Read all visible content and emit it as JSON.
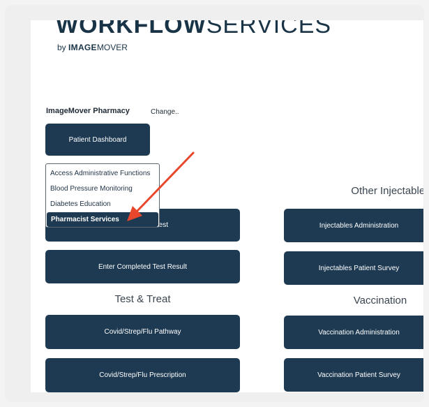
{
  "logo": {
    "main_bold": "WORKFLOW",
    "main_light": "SERVICES",
    "by": "by",
    "brand_bold": "IMAGE",
    "brand_light": "MOVER"
  },
  "pharmacy": {
    "name": "ImageMover Pharmacy",
    "change_label": "Change.."
  },
  "patient_dashboard_label": "Patient Dashboard",
  "dropdown": {
    "items": [
      "Access Administrative Functions",
      "Blood Pressure Monitoring",
      "Diabetes Education",
      "Pharmacist Services"
    ],
    "selected": "Pharmacist Services"
  },
  "left": {
    "partial_button_label": "est",
    "enter_result_label": "Enter Completed Test Result",
    "test_treat_title": "Test & Treat",
    "covid_pathway_label": "Covid/Strep/Flu Pathway",
    "covid_prescription_label": "Covid/Strep/Flu Prescription"
  },
  "right": {
    "other_injectables_title": "Other Injectables",
    "injectables_admin_label": "Injectables Administration",
    "injectables_survey_label": "Injectables Patient Survey",
    "vaccination_title": "Vaccination",
    "vaccination_admin_label": "Vaccination Administration",
    "vaccination_survey_label": "Vaccination Patient Survey"
  },
  "colors": {
    "button_bg": "#1d3a52",
    "arrow": "#e8472c",
    "text_dark": "#1f2a35"
  }
}
